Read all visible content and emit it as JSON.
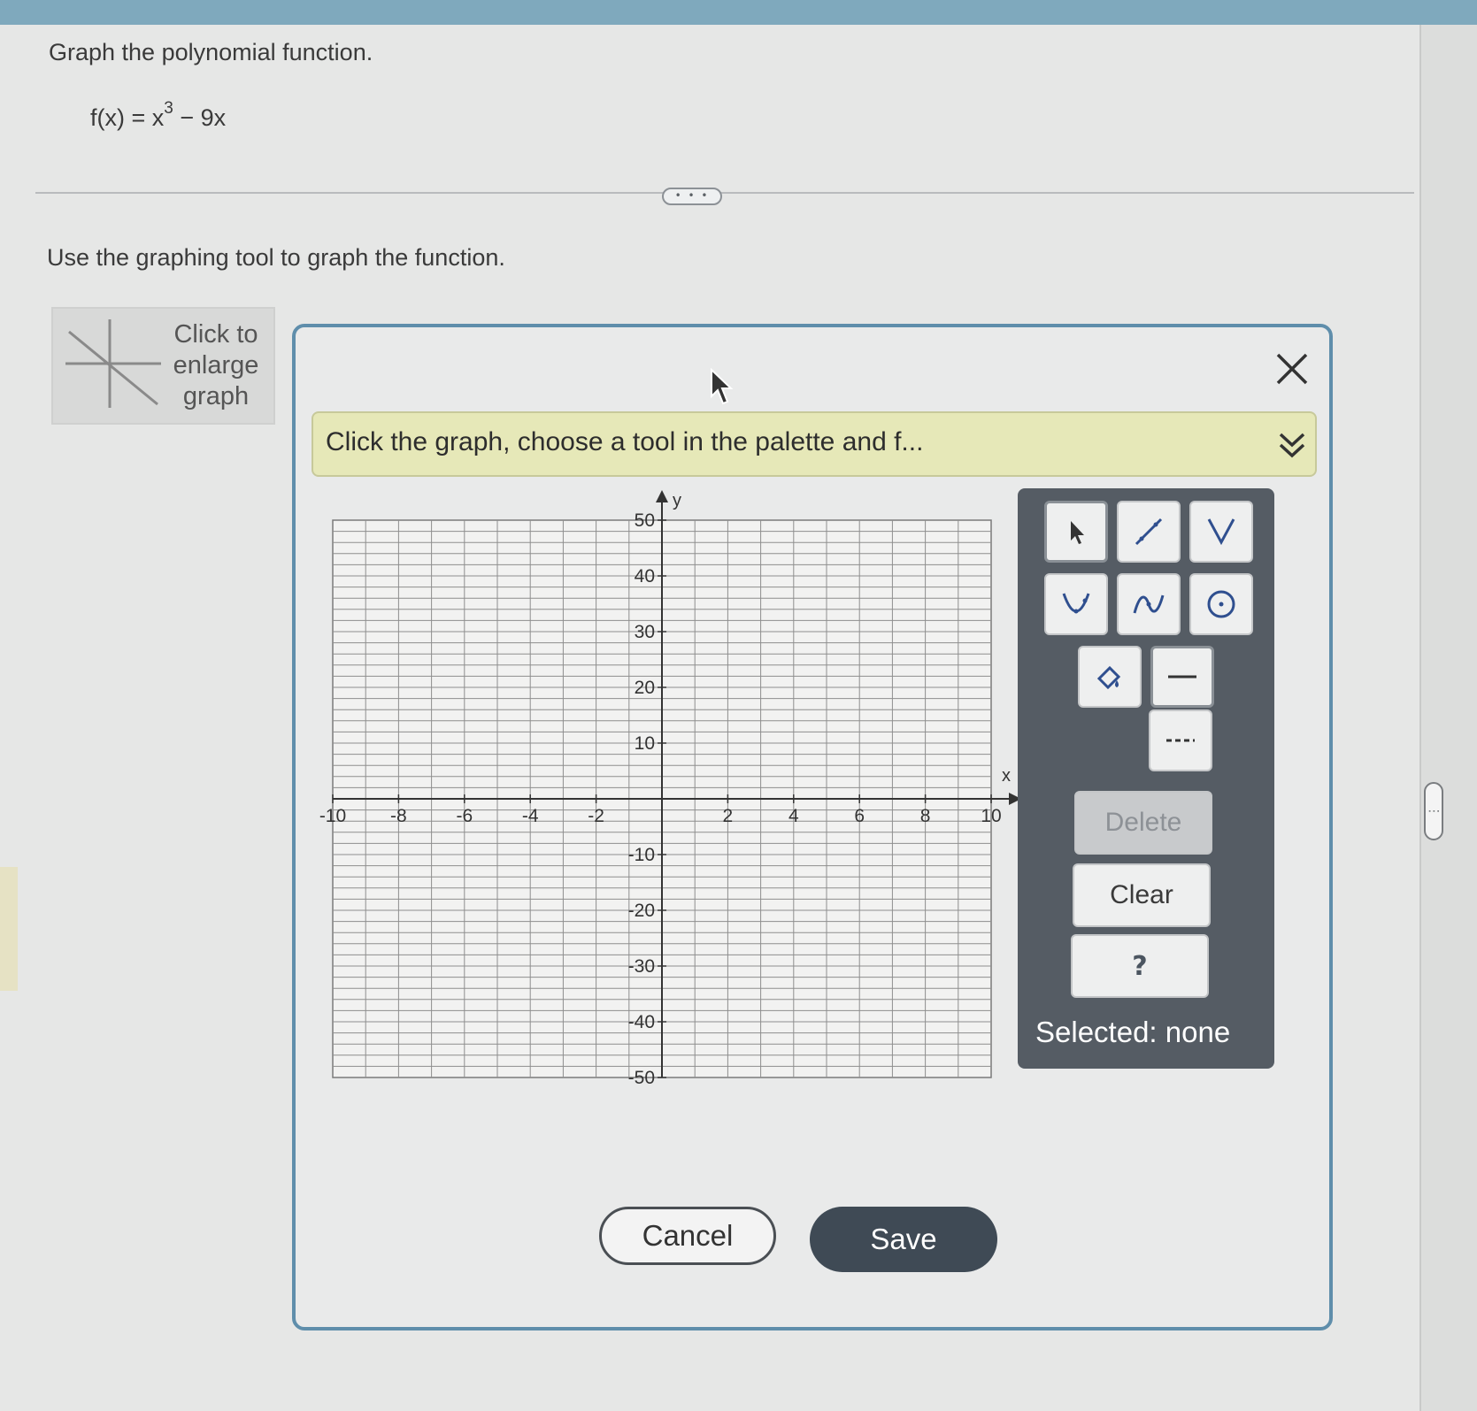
{
  "question": {
    "title": "Graph the polynomial function.",
    "function_base": "f(x) = x",
    "function_exponent": "3",
    "function_rest": " − 9x",
    "more_label": "• • •",
    "instruction": "Use the graphing tool to graph the function."
  },
  "enlarge": {
    "label": "Click to enlarge graph"
  },
  "dialog": {
    "hint": "Click the graph, choose a tool in the palette and f...",
    "close_icon": "close-icon",
    "expand_icon": "double-chevron-down-icon"
  },
  "graph": {
    "x_axis_label": "x",
    "y_axis_label": "y",
    "x_range": [
      -10,
      10
    ],
    "y_range": [
      -50,
      50
    ],
    "x_ticks": [
      "-10",
      "-8",
      "-6",
      "-4",
      "-2",
      "2",
      "4",
      "6",
      "8",
      "10"
    ],
    "y_ticks": [
      "50",
      "40",
      "30",
      "20",
      "10",
      "-10",
      "-20",
      "-30",
      "-40",
      "-50"
    ],
    "grid": true
  },
  "palette": {
    "tools": [
      "arrow-select-icon",
      "line-segment-icon",
      "absolute-value-icon",
      "parabola-icon",
      "cubic-curve-icon",
      "circle-icon",
      "fill-icon",
      "solid-line-icon",
      "dashed-line-icon"
    ],
    "delete_label": "Delete",
    "clear_label": "Clear",
    "help_label": "?",
    "selected_text": "Selected: none"
  },
  "actions": {
    "cancel_label": "Cancel",
    "save_label": "Save"
  }
}
